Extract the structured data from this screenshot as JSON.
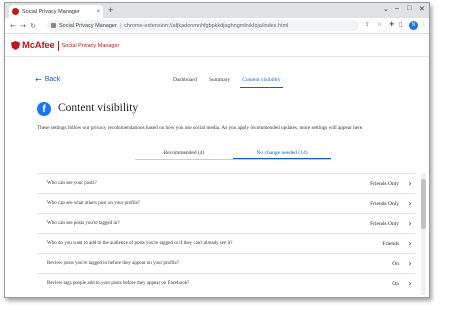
{
  "browser": {
    "tab_title": "Social Privacy Manager",
    "tab_close": "×",
    "new_tab": "+",
    "omnibox_app": "Social Privacy Manager",
    "omnibox_url": "chrome-extension://afjkadonmnhfgbpkkdjaghngmbvkfoja/index.html",
    "avatar_initial": "N",
    "window_controls": [
      "⌄",
      "–",
      "□",
      "✕"
    ],
    "nav_icons": [
      "arrow-left-icon",
      "arrow-right-icon",
      "reload-icon"
    ]
  },
  "header": {
    "logo_text": "McAfee",
    "product": "Social Privacy Manager",
    "brand_color": "#c01818"
  },
  "nav": {
    "back_label": "Back",
    "tabs": [
      {
        "label": "Dashboard",
        "active": false
      },
      {
        "label": "Summary",
        "active": false
      },
      {
        "label": "Content visibility",
        "active": true
      }
    ]
  },
  "page": {
    "icon_letter": "f",
    "title": "Content visibility",
    "description": "These settings follow our privacy recommendations based on how you use social media. As you apply recommended updates, more settings will appear here."
  },
  "subtabs": [
    {
      "label": "Recommended (4)",
      "active": false
    },
    {
      "label": "No change needed (14)",
      "active": true
    }
  ],
  "settings": [
    {
      "question": "Who can see your posts?",
      "value": "Friends Only"
    },
    {
      "question": "Who can see what others post on your profile?",
      "value": "Friends Only"
    },
    {
      "question": "Who can see posts you're tagged in?",
      "value": "Friends Only"
    },
    {
      "question": "Who do you want to add to the audience of posts you're tagged in if they can't already see it?",
      "value": "Friends"
    },
    {
      "question": "Review posts you're tagged in before they appear on your profile?",
      "value": "On"
    },
    {
      "question": "Review tags people add to your posts before they appear on Facebook?",
      "value": "On"
    }
  ]
}
